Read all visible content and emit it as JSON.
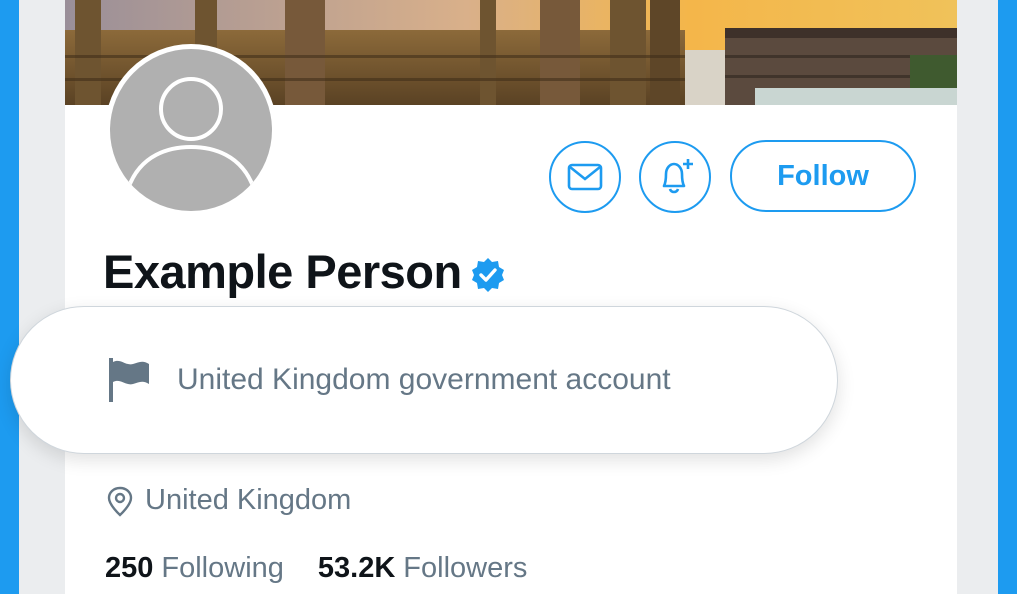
{
  "profile": {
    "name": "Example Person",
    "verified": true,
    "label": "United Kingdom government account",
    "location": "United Kingdom"
  },
  "actions": {
    "message_icon": "envelope-icon",
    "notify_icon": "bell-plus-icon",
    "follow_label": "Follow"
  },
  "stats": {
    "following_count": "250",
    "following_label": "Following",
    "followers_count": "53.2K",
    "followers_label": "Followers"
  },
  "colors": {
    "accent": "#1d9bf0",
    "text_primary": "#0f1419",
    "text_secondary": "#657786",
    "avatar_placeholder": "#b0b0b0"
  }
}
